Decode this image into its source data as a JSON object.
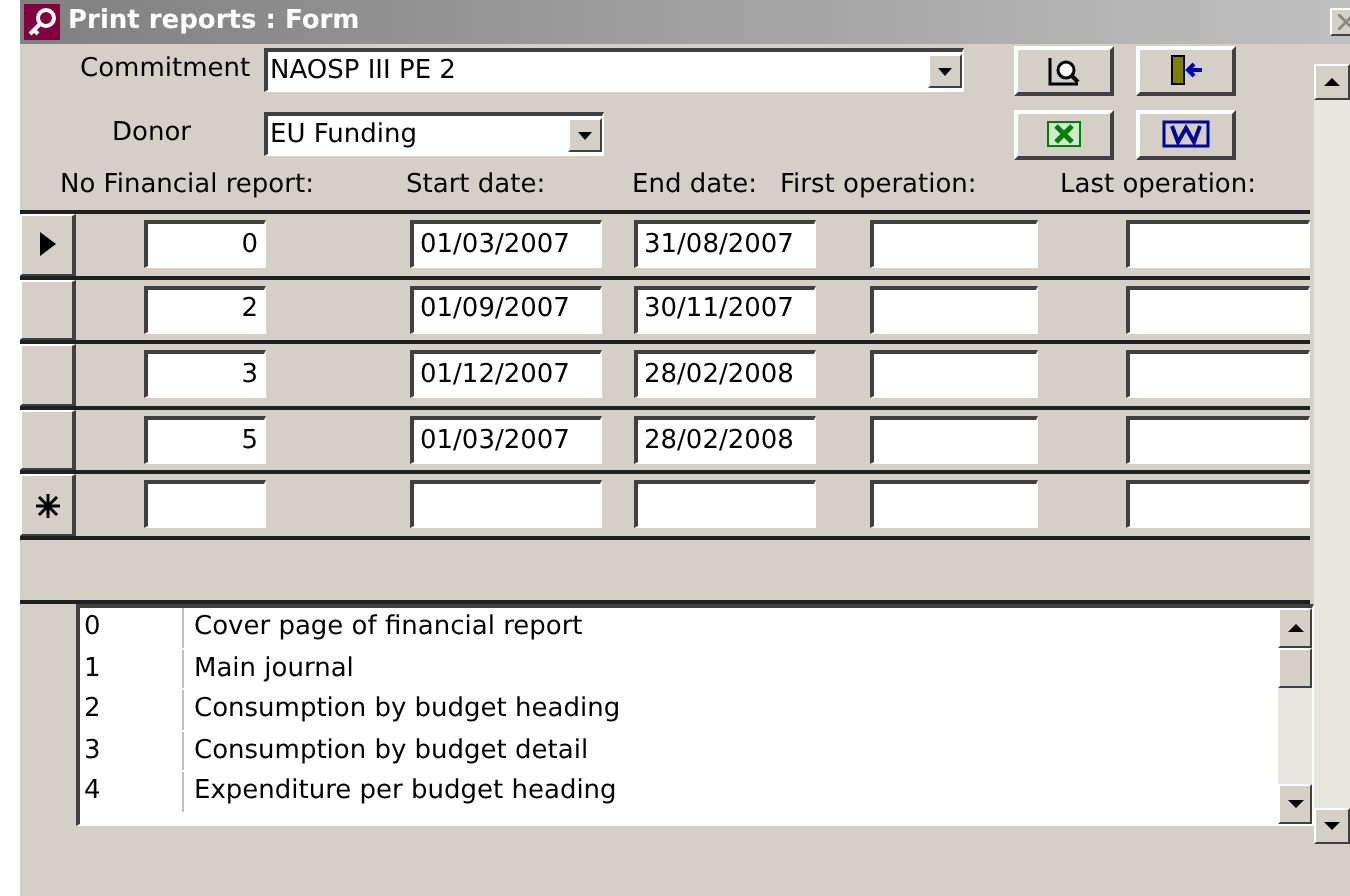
{
  "window": {
    "title": "Print reports : Form"
  },
  "commitment": {
    "label": "Commitment",
    "value": "NAOSP III PE 2"
  },
  "donor": {
    "label": "Donor",
    "value": "EU Funding"
  },
  "columns": [
    "No Financial report:",
    "Start date:",
    "End date:",
    "First operation:",
    "Last operation:"
  ],
  "rows": [
    {
      "kind": "current",
      "cells": [
        "0",
        "01/03/2007",
        "31/08/2007",
        "",
        ""
      ]
    },
    {
      "kind": "normal",
      "cells": [
        "2",
        "01/09/2007",
        "30/11/2007",
        "",
        ""
      ]
    },
    {
      "kind": "normal",
      "cells": [
        "3",
        "01/12/2007",
        "28/02/2008",
        "",
        ""
      ]
    },
    {
      "kind": "normal",
      "cells": [
        "5",
        "01/03/2007",
        "28/02/2008",
        "",
        ""
      ]
    },
    {
      "kind": "new",
      "cells": [
        "",
        "",
        "",
        "",
        ""
      ]
    }
  ],
  "reports": [
    {
      "code": "0",
      "name": "Cover page of financial report"
    },
    {
      "code": "1",
      "name": "Main journal"
    },
    {
      "code": "2",
      "name": "Consumption by budget heading"
    },
    {
      "code": "3",
      "name": "Consumption by budget detail"
    },
    {
      "code": "4",
      "name": "Expenditure per budget heading"
    }
  ]
}
